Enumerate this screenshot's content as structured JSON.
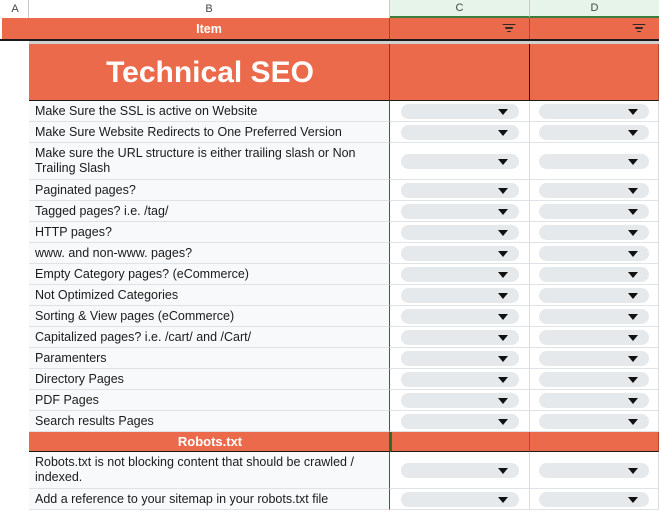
{
  "app": {
    "type": "spreadsheet"
  },
  "colors": {
    "accent_orange": "#EC6A4C",
    "header_select_green": "#e6f4ea",
    "select_border_green": "#2f6b2f",
    "row_background": "#f7f9fa",
    "chip_background": "#e6e9ec"
  },
  "column_headers": [
    {
      "label": "A",
      "selected": false
    },
    {
      "label": "B",
      "selected": false
    },
    {
      "label": "C",
      "selected": true
    },
    {
      "label": "D",
      "selected": true
    }
  ],
  "header_row": {
    "item_label": "Item",
    "filter_c": "filter-icon",
    "filter_d": "filter-icon"
  },
  "sections": [
    {
      "title": "Technical SEO",
      "rows": [
        {
          "item": "Make Sure the SSL is active on Website",
          "c": "",
          "d": ""
        },
        {
          "item": "Make Sure Website Redirects to One Preferred Version",
          "c": "",
          "d": ""
        },
        {
          "item": "Make sure the URL structure is either trailing slash or Non Trailing Slash",
          "c": "",
          "d": ""
        },
        {
          "item": "Paginated pages?",
          "c": "",
          "d": ""
        },
        {
          "item": "Tagged pages? i.e. /tag/",
          "c": "",
          "d": ""
        },
        {
          "item": "HTTP pages?",
          "c": "",
          "d": ""
        },
        {
          "item": "www. and non-www. pages?",
          "c": "",
          "d": ""
        },
        {
          "item": "Empty Category pages? (eCommerce)",
          "c": "",
          "d": ""
        },
        {
          "item": "Not Optimized Categories",
          "c": "",
          "d": ""
        },
        {
          "item": "Sorting & View pages (eCommerce)",
          "c": "",
          "d": ""
        },
        {
          "item": "Capitalized pages? i.e. /cart/ and /Cart/",
          "c": "",
          "d": ""
        },
        {
          "item": "Paramenters",
          "c": "",
          "d": ""
        },
        {
          "item": "Directory Pages",
          "c": "",
          "d": ""
        },
        {
          "item": "PDF Pages",
          "c": "",
          "d": ""
        },
        {
          "item": "Search results Pages",
          "c": "",
          "d": ""
        }
      ]
    },
    {
      "title": "Robots.txt",
      "rows": [
        {
          "item": "Robots.txt is not blocking content that should be crawled / indexed.",
          "c": "",
          "d": ""
        },
        {
          "item": "Add a reference to your sitemap in your robots.txt file",
          "c": "",
          "d": ""
        }
      ]
    }
  ]
}
